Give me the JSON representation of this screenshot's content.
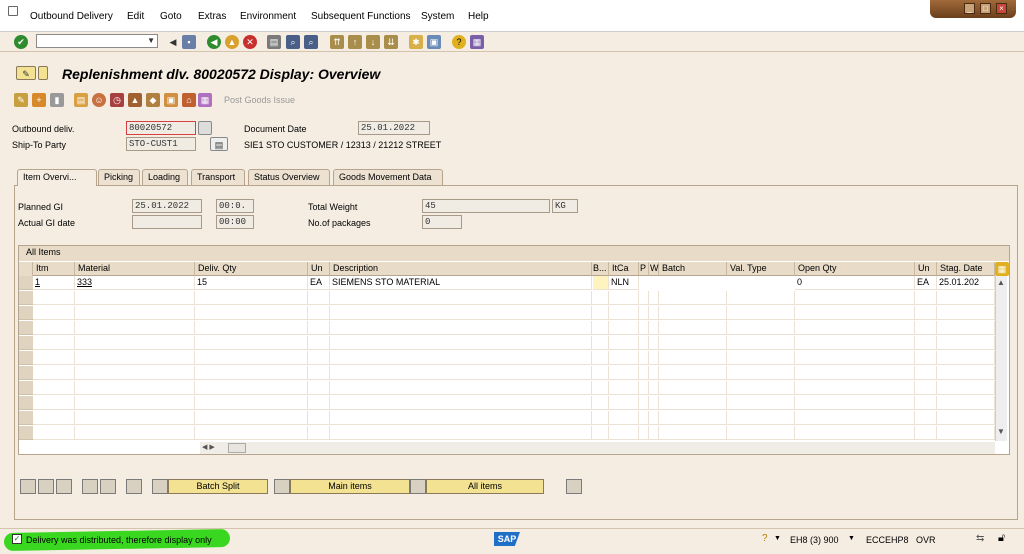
{
  "menu": {
    "items": [
      "Outbound Delivery",
      "Edit",
      "Goto",
      "Extras",
      "Environment",
      "Subsequent Functions",
      "System",
      "Help"
    ]
  },
  "title": "Replenishment dlv. 80020572 Display: Overview",
  "app_toolbar": {
    "post_goods_issue": "Post Goods Issue"
  },
  "header": {
    "outbound_deliv_label": "Outbound deliv.",
    "outbound_deliv_value": "80020572",
    "document_date_label": "Document Date",
    "document_date_value": "25.01.2022",
    "ship_to_label": "Ship-To Party",
    "ship_to_value": "STO-CUST1",
    "ship_to_desc": "SIE1 STO CUSTOMER / 12313 / 21212 STREET"
  },
  "tabs": [
    "Item Overvi...",
    "Picking",
    "Loading",
    "Transport",
    "Status Overview",
    "Goods Movement Data"
  ],
  "overview": {
    "planned_gi_label": "Planned GI",
    "planned_gi_date": "25.01.2022",
    "planned_gi_time": "00:0.",
    "actual_gi_label": "Actual GI date",
    "actual_gi_date": "",
    "actual_gi_time": "00:00",
    "total_weight_label": "Total Weight",
    "total_weight_value": "45",
    "total_weight_unit": "KG",
    "packages_label": "No.of packages",
    "packages_value": "0"
  },
  "grid": {
    "title": "All Items",
    "columns": [
      "Itm",
      "Material",
      "Deliv. Qty",
      "Un",
      "Description",
      "B...",
      "ItCa",
      "P",
      "W",
      "Batch",
      "Val. Type",
      "Open Qty",
      "Un",
      "Stag. Date"
    ],
    "rows": [
      {
        "itm": "1",
        "material": "333",
        "qty": "15",
        "un": "EA",
        "desc": "SIEMENS STO MATERIAL",
        "b": "",
        "itca": "NLN",
        "p": "",
        "w": "",
        "batch": "",
        "valtype": "",
        "openqty": "0",
        "un2": "EA",
        "stag": "25.01.202"
      }
    ]
  },
  "buttons": {
    "batch_split": "Batch Split",
    "main_items": "Main items",
    "all_items": "All items"
  },
  "status": {
    "message": "Delivery was distributed, therefore display only",
    "system": "EH8 (3) 900",
    "server": "ECCEHP8",
    "mode": "OVR"
  },
  "colors": {
    "accent": "#39d71f",
    "sap_blue": "#1f6fc7"
  }
}
